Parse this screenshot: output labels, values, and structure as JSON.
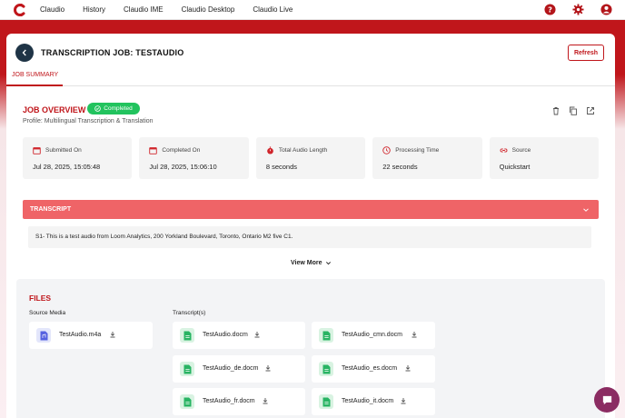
{
  "nav": {
    "logo_letter": "C",
    "items": [
      "Claudio",
      "History",
      "Claudio IME",
      "Claudio Desktop",
      "Claudio Live"
    ],
    "icons": [
      "help-icon",
      "gear-icon",
      "user-icon"
    ]
  },
  "header": {
    "title": "TRANSCRIPTION JOB: TESTAUDIO",
    "refresh_label": "Refresh"
  },
  "tabs": [
    {
      "label": "JOB SUMMARY",
      "active": true
    }
  ],
  "overview": {
    "title": "JOB OVERVIEW",
    "status": "Completed",
    "profile": "Profile: Multilingual Transcription & Translation",
    "icons": [
      "trash-icon",
      "copy-icon",
      "open-external-icon"
    ]
  },
  "stats": [
    {
      "icon": "calendar-icon",
      "label": "Submitted On",
      "value": "Jul 28, 2025, 15:05:48"
    },
    {
      "icon": "calendar-icon",
      "label": "Completed On",
      "value": "Jul 28, 2025, 15:06:10"
    },
    {
      "icon": "stopwatch-icon",
      "label": "Total Audio Length",
      "value": "8 seconds"
    },
    {
      "icon": "clock-icon",
      "label": "Processing Time",
      "value": "22 seconds"
    },
    {
      "icon": "link-icon",
      "label": "Source",
      "value": "Quickstart"
    }
  ],
  "transcript": {
    "title": "TRANSCRIPT",
    "text": "S1- This is a test audio from Loom Analytics, 200 Yorkland Boulevard, Toronto, Ontario M2 five C1.",
    "view_more": "View More"
  },
  "files": {
    "title": "FILES",
    "source_label": "Source Media",
    "transcripts_label": "Transcript(s)",
    "source_file": "TestAudio.m4a",
    "transcripts": [
      "TestAudio.docm",
      "TestAudio_cmn.docm",
      "TestAudio_de.docm",
      "TestAudio_es.docm",
      "TestAudio_fr.docm",
      "TestAudio_it.docm"
    ]
  },
  "colors": {
    "brand": "#c0161b",
    "success": "#22c35e",
    "transcript_bar": "#ef6467",
    "dark_button": "#1f3446",
    "chat": "#8b2c62"
  }
}
